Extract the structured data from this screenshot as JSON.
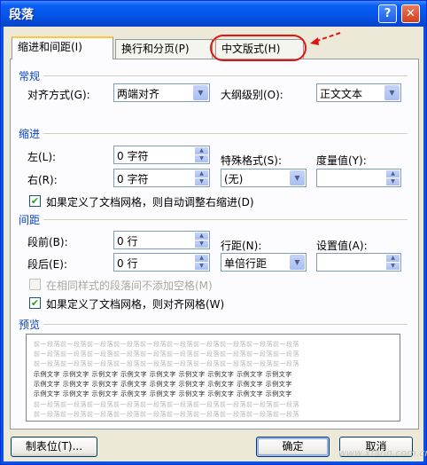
{
  "window": {
    "title": "段落",
    "help_label": "?",
    "close_label": "✕"
  },
  "tabs": [
    {
      "label": "缩进和间距(I)"
    },
    {
      "label": "换行和分页(P)"
    },
    {
      "label": "中文版式(H)"
    }
  ],
  "general": {
    "heading": "常规",
    "alignment_label": "对齐方式(G):",
    "alignment_value": "两端对齐",
    "outline_label": "大纲级别(O):",
    "outline_value": "正文文本"
  },
  "indent": {
    "heading": "缩进",
    "left_label": "左(L):",
    "left_value": "0 字符",
    "right_label": "右(R):",
    "right_value": "0 字符",
    "special_label": "特殊格式(S):",
    "special_value": "(无)",
    "measure_label": "度量值(Y):",
    "measure_value": "",
    "auto_adjust_label": "如果定义了文档网格，则自动调整右缩进(D)"
  },
  "spacing": {
    "heading": "间距",
    "before_label": "段前(B):",
    "before_value": "0 行",
    "after_label": "段后(E):",
    "after_value": "0 行",
    "line_label": "行距(N):",
    "line_value": "单倍行距",
    "setting_label": "设置值(A):",
    "setting_value": "",
    "no_space_label": "在相同样式的段落间不添加空格(M)",
    "snap_grid_label": "如果定义了文档网格，则对齐网格(W)"
  },
  "preview": {
    "heading": "预览",
    "gray_line": "前一段落前一段落前一段落前一段落前一段落前一段落前一段落前一段落前一段落前一段落",
    "sample_line": "示例文字 示例文字 示例文字 示例文字 示例文字 示例文字 示例文字 示例文字 示例文字",
    "gray_color": "#b4b4b4"
  },
  "buttons": {
    "tabs_label": "制表位(T)...",
    "ok_label": "确定",
    "cancel_label": "取消"
  },
  "annotation_color": "#e01515",
  "watermark": "www.xfann.com.cn"
}
